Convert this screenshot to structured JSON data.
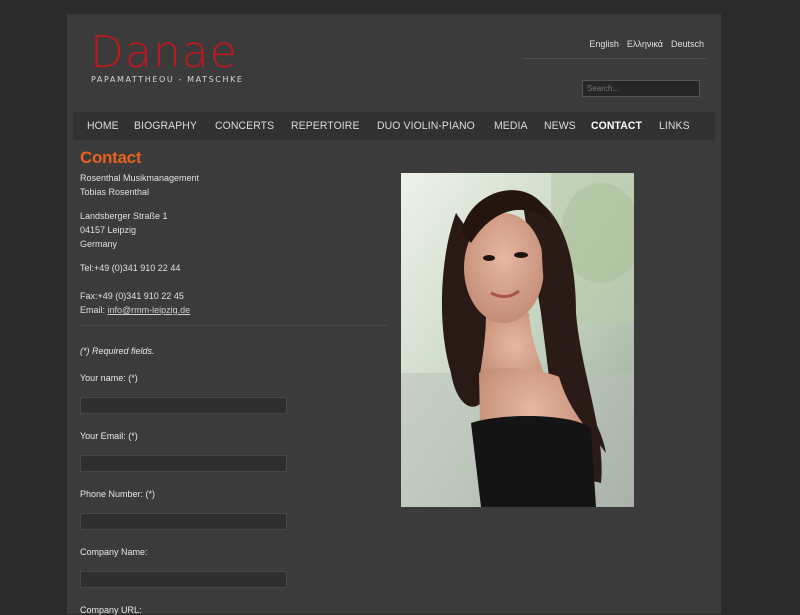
{
  "logo": {
    "title": "Danae",
    "subtitle": "PAPAMATTHEOU - MATSCHKE"
  },
  "languages": [
    "English",
    "Ελληνικά",
    "Deutsch"
  ],
  "search": {
    "placeholder": "Search..."
  },
  "nav": {
    "items": [
      "HOME",
      "BIOGRAPHY",
      "CONCERTS",
      "REPERTOIRE",
      "DUO VIOLIN-PIANO",
      "MEDIA",
      "NEWS",
      "CONTACT",
      "LINKS"
    ],
    "active": "CONTACT"
  },
  "contact": {
    "heading": "Contact",
    "org": "Rosenthal Musikmanagement",
    "person": "Tobias Rosenthal",
    "street": "Landsberger Straße 1",
    "city": "04157 Leipzig",
    "country": "Germany",
    "tel": "Tel:+49 (0)341 910 22 44",
    "fax": "Fax:+49 (0)341 910 22 45",
    "email_label": "Email: ",
    "email": "info@rmm-leipzig.de"
  },
  "form": {
    "required_note": "(*) Required fields.",
    "fields": [
      "Your name: (*)",
      "Your Email: (*)",
      "Phone Number: (*)",
      "Company Name:",
      "Company URL:"
    ]
  },
  "colors": {
    "accent": "#e8601c",
    "logo": "#c0191f"
  }
}
